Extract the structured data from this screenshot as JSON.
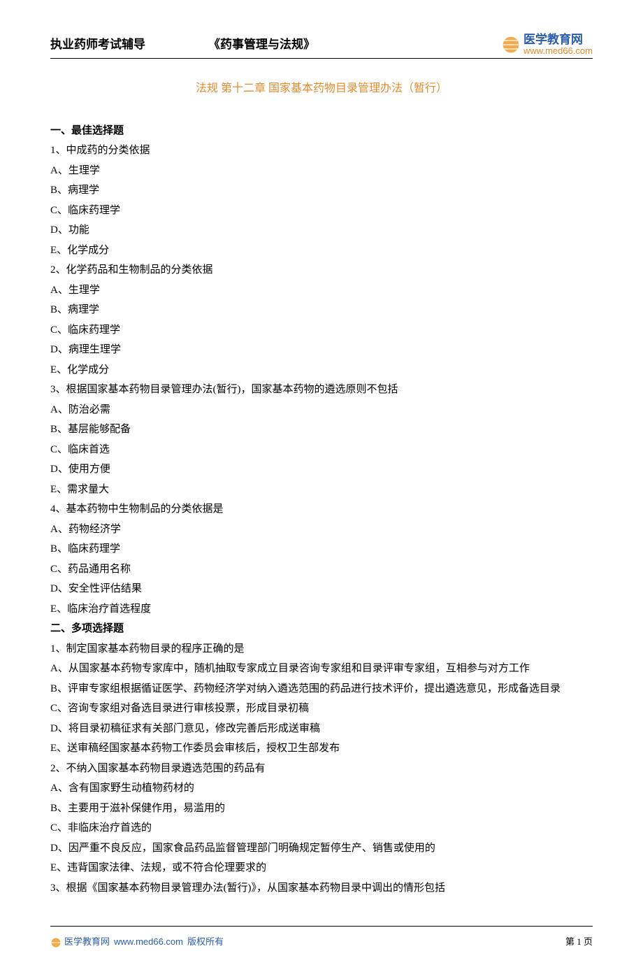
{
  "header": {
    "left": "执业药师考试辅导",
    "mid": "《药事管理与法规》",
    "logo_cn": "医学教育网",
    "logo_url": "www.med66.com"
  },
  "chapter_title": "法规 第十二章 国家基本药物目录管理办法（暂行）",
  "body_lines": [
    {
      "bold": true,
      "text": "一、最佳选择题"
    },
    {
      "text": "1、中成药的分类依据"
    },
    {
      "text": "A、生理学"
    },
    {
      "text": "B、病理学"
    },
    {
      "text": "C、临床药理学"
    },
    {
      "text": "D、功能"
    },
    {
      "text": "E、化学成分"
    },
    {
      "text": "2、化学药品和生物制品的分类依据"
    },
    {
      "text": "A、生理学"
    },
    {
      "text": "B、病理学"
    },
    {
      "text": "C、临床药理学"
    },
    {
      "text": "D、病理生理学"
    },
    {
      "text": "E、化学成分"
    },
    {
      "text": "3、根据国家基本药物目录管理办法(暂行)，国家基本药物的遴选原则不包括"
    },
    {
      "text": "A、防治必需"
    },
    {
      "text": "B、基层能够配备"
    },
    {
      "text": "C、临床首选"
    },
    {
      "text": "D、使用方便"
    },
    {
      "text": "E、需求量大"
    },
    {
      "text": "4、基本药物中生物制品的分类依据是"
    },
    {
      "text": "A、药物经济学"
    },
    {
      "text": "B、临床药理学"
    },
    {
      "text": "C、药品通用名称"
    },
    {
      "text": "D、安全性评估结果"
    },
    {
      "text": "E、临床治疗首选程度"
    },
    {
      "bold": true,
      "text": "二、多项选择题"
    },
    {
      "text": "1、制定国家基本药物目录的程序正确的是"
    },
    {
      "text": "A、从国家基本药物专家库中，随机抽取专家成立目录咨询专家组和目录评审专家组，互相参与对方工作"
    },
    {
      "text": "B、评审专家组根据循证医学、药物经济学对纳入遴选范围的药品进行技术评价，提出遴选意见，形成备选目录"
    },
    {
      "text": "C、咨询专家组对备选目录进行审核投票，形成目录初稿"
    },
    {
      "text": "D、将目录初稿征求有关部门意见，修改完善后形成送审稿"
    },
    {
      "text": "E、送审稿经国家基本药物工作委员会审核后，授权卫生部发布"
    },
    {
      "text": "2、不纳入国家基本药物目录遴选范围的药品有"
    },
    {
      "text": "A、含有国家野生动植物药材的"
    },
    {
      "text": "B、主要用于滋补保健作用，易滥用的"
    },
    {
      "text": "C、非临床治疗首选的"
    },
    {
      "text": "D、因严重不良反应，国家食品药品监督管理部门明确规定暂停生产、销售或使用的"
    },
    {
      "text": "E、违背国家法律、法规，或不符合伦理要求的"
    },
    {
      "text": "3、根据《国家基本药物目录管理办法(暂行)》，从国家基本药物目录中调出的情形包括"
    }
  ],
  "footer": {
    "cn": "医学教育网",
    "url": "www.med66.com",
    "copy": "版权所有",
    "page": "第 1 页"
  }
}
